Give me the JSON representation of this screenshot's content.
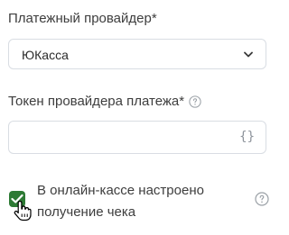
{
  "provider": {
    "label": "Платежный провайдер*",
    "value": "ЮКасса"
  },
  "token": {
    "label": "Токен провайдера платежа*",
    "value": "",
    "variable_icon_text": "{}"
  },
  "receipt": {
    "checked": true,
    "label": "В онлайн-кассе настроено получение чека"
  },
  "icons": {
    "help": "question-circle-icon",
    "chevron": "chevron-down-icon",
    "variables": "braces-icon",
    "cursor": "hand-pointer-icon",
    "check": "check-icon"
  },
  "colors": {
    "checkbox": "#2d7a34",
    "border": "#d9dde3",
    "text": "#3d3d3d"
  }
}
